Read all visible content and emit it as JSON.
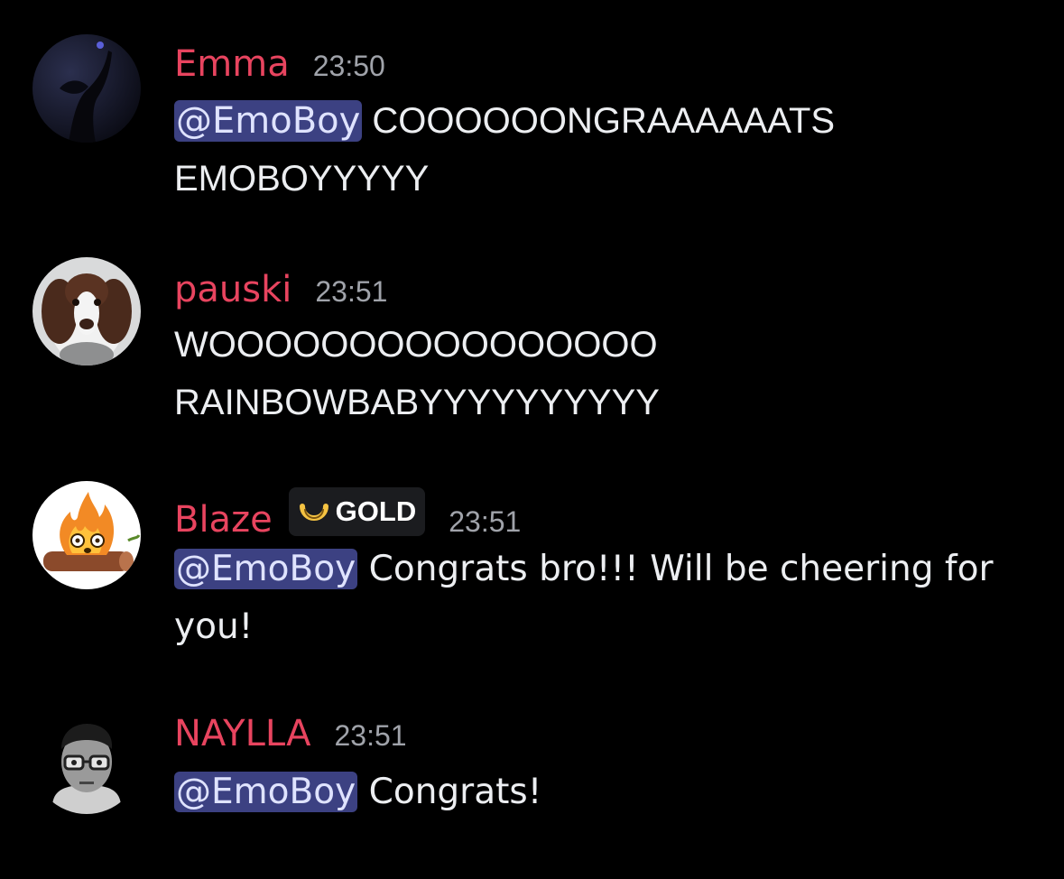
{
  "messages": [
    {
      "username": "Emma",
      "time": "23:50",
      "mention": "@EmoBoy",
      "text": "COOOOOONGRAAAAAATS EMOBOYYYYY"
    },
    {
      "username": "pauski",
      "time": "23:51",
      "mention": "",
      "text": "WOOOOOOOOOOOOOOOO RAINBOWBABYYYYYYYYYY"
    },
    {
      "username": "Blaze",
      "time": "23:51",
      "badge": {
        "label": "GOLD",
        "icon": "gold-ring-icon"
      },
      "mention": "@EmoBoy",
      "text": "Congrats bro!!! Will be cheering for you!"
    },
    {
      "username": "NAYLLA",
      "time": "23:51",
      "mention": "@EmoBoy",
      "text": "Congrats!"
    }
  ],
  "colors": {
    "background": "#000000",
    "username": "#e8445f",
    "timestamp": "#a0a3aa",
    "mention_bg": "#3c4182",
    "mention_text": "#dfe3ff"
  }
}
